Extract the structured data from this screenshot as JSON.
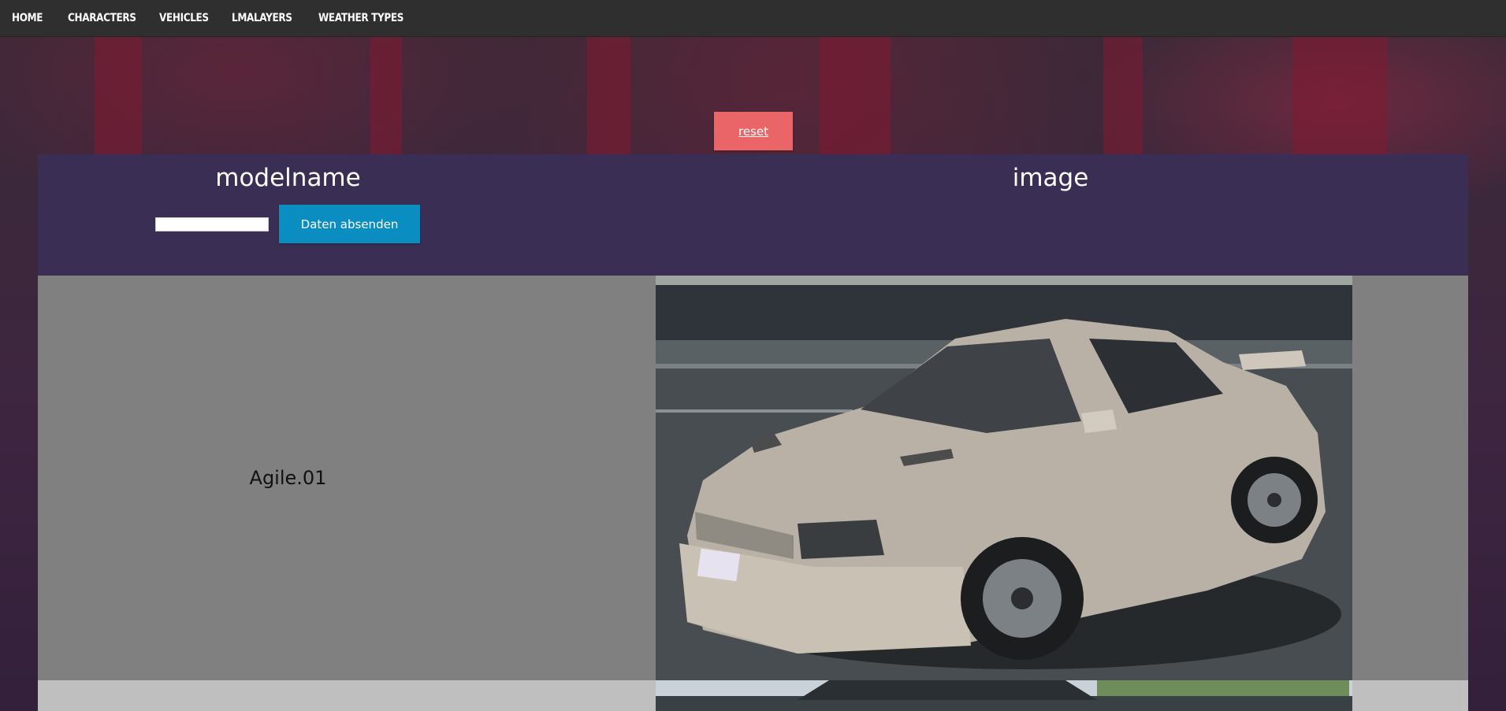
{
  "nav": {
    "items": [
      {
        "label": "HOME"
      },
      {
        "label": "CHARACTERS"
      },
      {
        "label": "VEHICLES"
      },
      {
        "label": "LMALAYERS"
      },
      {
        "label": "WEATHER TYPES"
      }
    ]
  },
  "controls": {
    "reset_label": "reset",
    "submit_label": "Daten absenden",
    "filter_value": ""
  },
  "table": {
    "headers": {
      "model": "modelname",
      "image": "image"
    },
    "rows": [
      {
        "modelname": "Agile.01",
        "image_icon": "car-photo"
      },
      {
        "modelname": "",
        "image_icon": "car-photo"
      }
    ]
  },
  "colors": {
    "nav_bg": "#2f2f2f",
    "header_bg": "#3a2e54",
    "reset": "#e96567",
    "submit": "#0a8dc0",
    "row_odd": "#808080",
    "row_even": "#bfbfbf"
  }
}
